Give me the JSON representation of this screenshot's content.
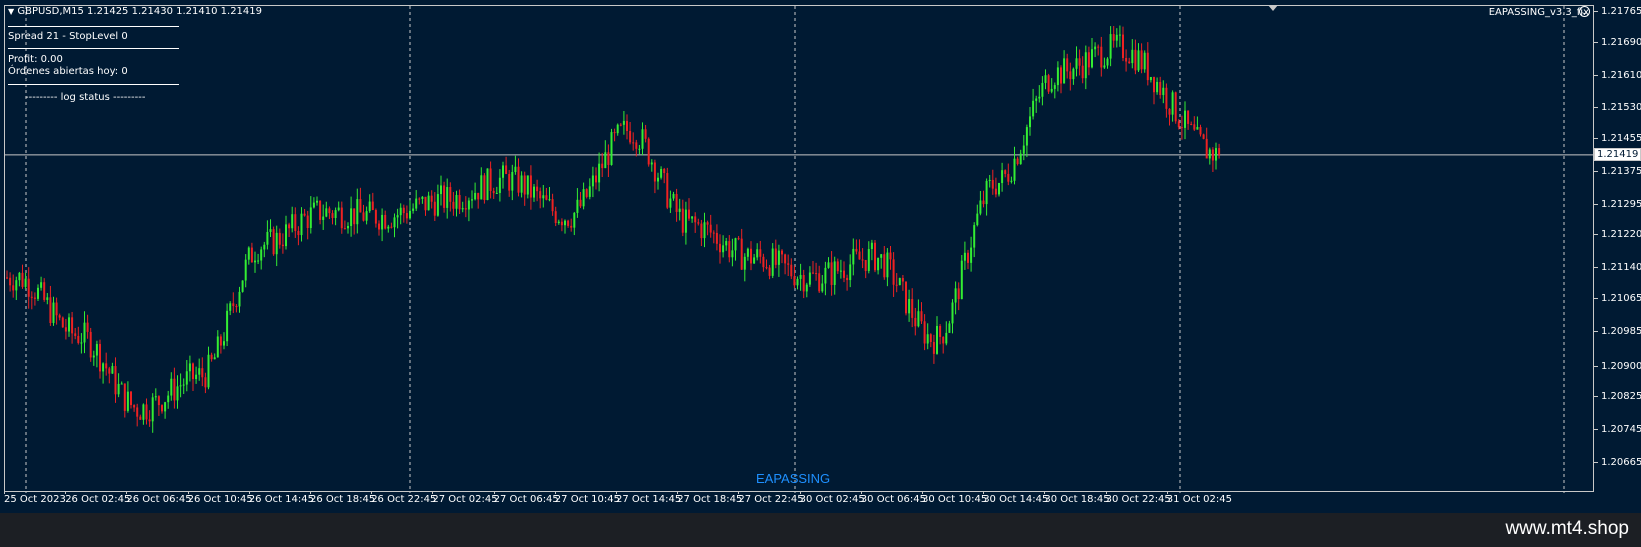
{
  "header": {
    "symbol_info": "GBPUSD,M15  1.21425 1.21430 1.21410 1.21419",
    "spread": "Spread 21 - StopLevel 0",
    "profit": "Profit: 0.00",
    "orders": "Órdenes abiertas hoy: 0",
    "log_status": "--------- log status ---------"
  },
  "ea_name": "EAPASSING_v3.3_fix",
  "center_brand": "EAPASSING",
  "watermark": "www.mt4.shop",
  "current_price": "1.21419",
  "price_axis": [
    "1.21765",
    "1.21690",
    "1.21610",
    "1.21530",
    "1.21455",
    "1.21375",
    "1.21295",
    "1.21220",
    "1.21140",
    "1.21065",
    "1.20985",
    "1.20900",
    "1.20825",
    "1.20745",
    "1.20665"
  ],
  "time_axis": [
    "25 Oct 2023",
    "26 Oct 02:45",
    "26 Oct 06:45",
    "26 Oct 10:45",
    "26 Oct 14:45",
    "26 Oct 18:45",
    "26 Oct 22:45",
    "27 Oct 02:45",
    "27 Oct 06:45",
    "27 Oct 10:45",
    "27 Oct 14:45",
    "27 Oct 18:45",
    "27 Oct 22:45",
    "30 Oct 02:45",
    "30 Oct 06:45",
    "30 Oct 10:45",
    "30 Oct 14:45",
    "30 Oct 18:45",
    "30 Oct 22:45",
    "31 Oct 02:45"
  ],
  "colors": {
    "background": "#001a33",
    "bull": "#33ee33",
    "bear": "#ee2222",
    "grid": "#c8c8c8",
    "brand": "#1e90ff"
  },
  "chart_data": {
    "type": "candlestick",
    "symbol": "GBPUSD",
    "timeframe": "M15",
    "ylim": [
      1.20665,
      1.21765
    ],
    "path_close_keypoints": [
      [
        "25 Oct 2023",
        1.2112
      ],
      [
        "26 Oct 02:45",
        1.2098
      ],
      [
        "26 Oct 06:45",
        1.208
      ],
      [
        "26 Oct 10:45",
        1.2088
      ],
      [
        "26 Oct 14:45",
        1.212
      ],
      [
        "26 Oct 18:45",
        1.2128
      ],
      [
        "26 Oct 22:45",
        1.2127
      ],
      [
        "27 Oct 02:45",
        1.2131
      ],
      [
        "27 Oct 06:45",
        1.2136
      ],
      [
        "27 Oct 10:45",
        1.2127
      ],
      [
        "27 Oct 14:45",
        1.2148
      ],
      [
        "27 Oct 18:45",
        1.2125
      ],
      [
        "27 Oct 22:45",
        1.2117
      ],
      [
        "30 Oct 02:45",
        1.2112
      ],
      [
        "30 Oct 06:45",
        1.2117
      ],
      [
        "30 Oct 10:45",
        1.2097
      ],
      [
        "30 Oct 14:45",
        1.2135
      ],
      [
        "30 Oct 18:45",
        1.2162
      ],
      [
        "30 Oct 22:45",
        1.2168
      ],
      [
        "31 Oct 02:45",
        1.21419
      ]
    ],
    "last": {
      "open": 1.21425,
      "high": 1.2143,
      "low": 1.2141,
      "close": 1.21419
    }
  }
}
